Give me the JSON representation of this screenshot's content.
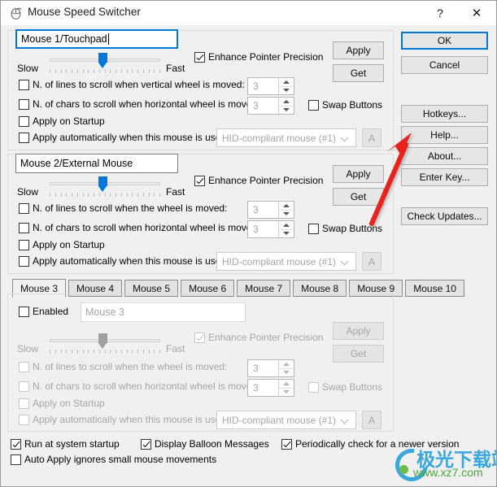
{
  "window": {
    "title": "Mouse Speed Switcher",
    "icon": "mouse-icon",
    "help_label": "?",
    "close_label": "✕"
  },
  "labels": {
    "slow": "Slow",
    "fast": "Fast",
    "enhance_pointer_precision": "Enhance Pointer Precision",
    "swap_buttons": "Swap Buttons",
    "apply_on_startup": "Apply on Startup",
    "apply_automatically": "Apply automatically when this mouse is used:",
    "lines_vertical": "N. of lines to scroll when vertical wheel is moved:",
    "lines_wheel": "N. of lines to scroll when the wheel is moved:",
    "chars_horizontal": "N. of chars to scroll when  horizontal wheel is moved:",
    "apply": "Apply",
    "get": "Get",
    "auto_button": "A",
    "enabled": "Enabled"
  },
  "mouse1": {
    "name_value": "Mouse 1/Touchpad",
    "speed_percent": 50,
    "enhance_pointer_precision": true,
    "lines_label": "N. of lines to scroll when vertical wheel is moved:",
    "lines_checked": false,
    "lines_value": "3",
    "chars_label": "N. of chars to scroll when  horizontal wheel is moved:",
    "chars_checked": false,
    "chars_value": "3",
    "swap_buttons": false,
    "apply_on_startup": false,
    "apply_automatically": false,
    "device": "HID-compliant mouse (#1)",
    "apply_label": "Apply",
    "get_label": "Get"
  },
  "mouse2": {
    "name_value": "Mouse 2/External Mouse",
    "speed_percent": 50,
    "enhance_pointer_precision": true,
    "lines_label": "N. of lines to scroll when the wheel is moved:",
    "lines_checked": false,
    "lines_value": "3",
    "chars_label": "N. of chars to scroll when  horizontal wheel is moved:",
    "chars_checked": false,
    "chars_value": "3",
    "swap_buttons": false,
    "apply_on_startup": false,
    "apply_automatically": false,
    "device": "HID-compliant mouse (#1)",
    "apply_label": "Apply",
    "get_label": "Get"
  },
  "tabs": [
    {
      "label": "Mouse 3",
      "active": true
    },
    {
      "label": "Mouse 4",
      "active": false
    },
    {
      "label": "Mouse 5",
      "active": false
    },
    {
      "label": "Mouse 6",
      "active": false
    },
    {
      "label": "Mouse 7",
      "active": false
    },
    {
      "label": "Mouse 8",
      "active": false
    },
    {
      "label": "Mouse 9",
      "active": false
    },
    {
      "label": "Mouse 10",
      "active": false
    }
  ],
  "mouse3": {
    "enabled_label": "Enabled",
    "enabled_checked": false,
    "name_placeholder": "Mouse 3",
    "speed_percent": 50,
    "enhance_pointer_precision": true,
    "lines_label": "N. of lines to scroll when the wheel is moved:",
    "lines_checked": false,
    "lines_value": "3",
    "chars_label": "N. of chars to scroll when  horizontal wheel is moved:",
    "chars_checked": false,
    "chars_value": "3",
    "swap_buttons": false,
    "apply_on_startup": false,
    "apply_automatically": false,
    "device": "HID-compliant mouse (#1)",
    "apply_label": "Apply",
    "get_label": "Get"
  },
  "side_buttons": {
    "ok": "OK",
    "cancel": "Cancel",
    "hotkeys": "Hotkeys...",
    "help": "Help...",
    "about": "About...",
    "enter_key": "Enter Key...",
    "check_updates": "Check Updates..."
  },
  "footer": {
    "run_at_startup": {
      "label": "Run at system startup",
      "checked": true
    },
    "display_balloon": {
      "label": "Display Balloon Messages",
      "checked": true
    },
    "periodic_check": {
      "label": "Periodically check for a newer version",
      "checked": true
    },
    "auto_apply_ignores": {
      "label": "Auto Apply ignores small mouse movements",
      "checked": false
    }
  },
  "annotation": {
    "type": "red-arrow",
    "color": "#e8201a",
    "points_to": "Help..."
  },
  "watermark": {
    "chinese": "极光下载站",
    "url": "www.xz7.com"
  },
  "colors": {
    "accent": "#0078d7",
    "window_bg": "#f0f0f0",
    "titlebar_bg": "#ffffff",
    "annotation_red": "#e8201a"
  }
}
